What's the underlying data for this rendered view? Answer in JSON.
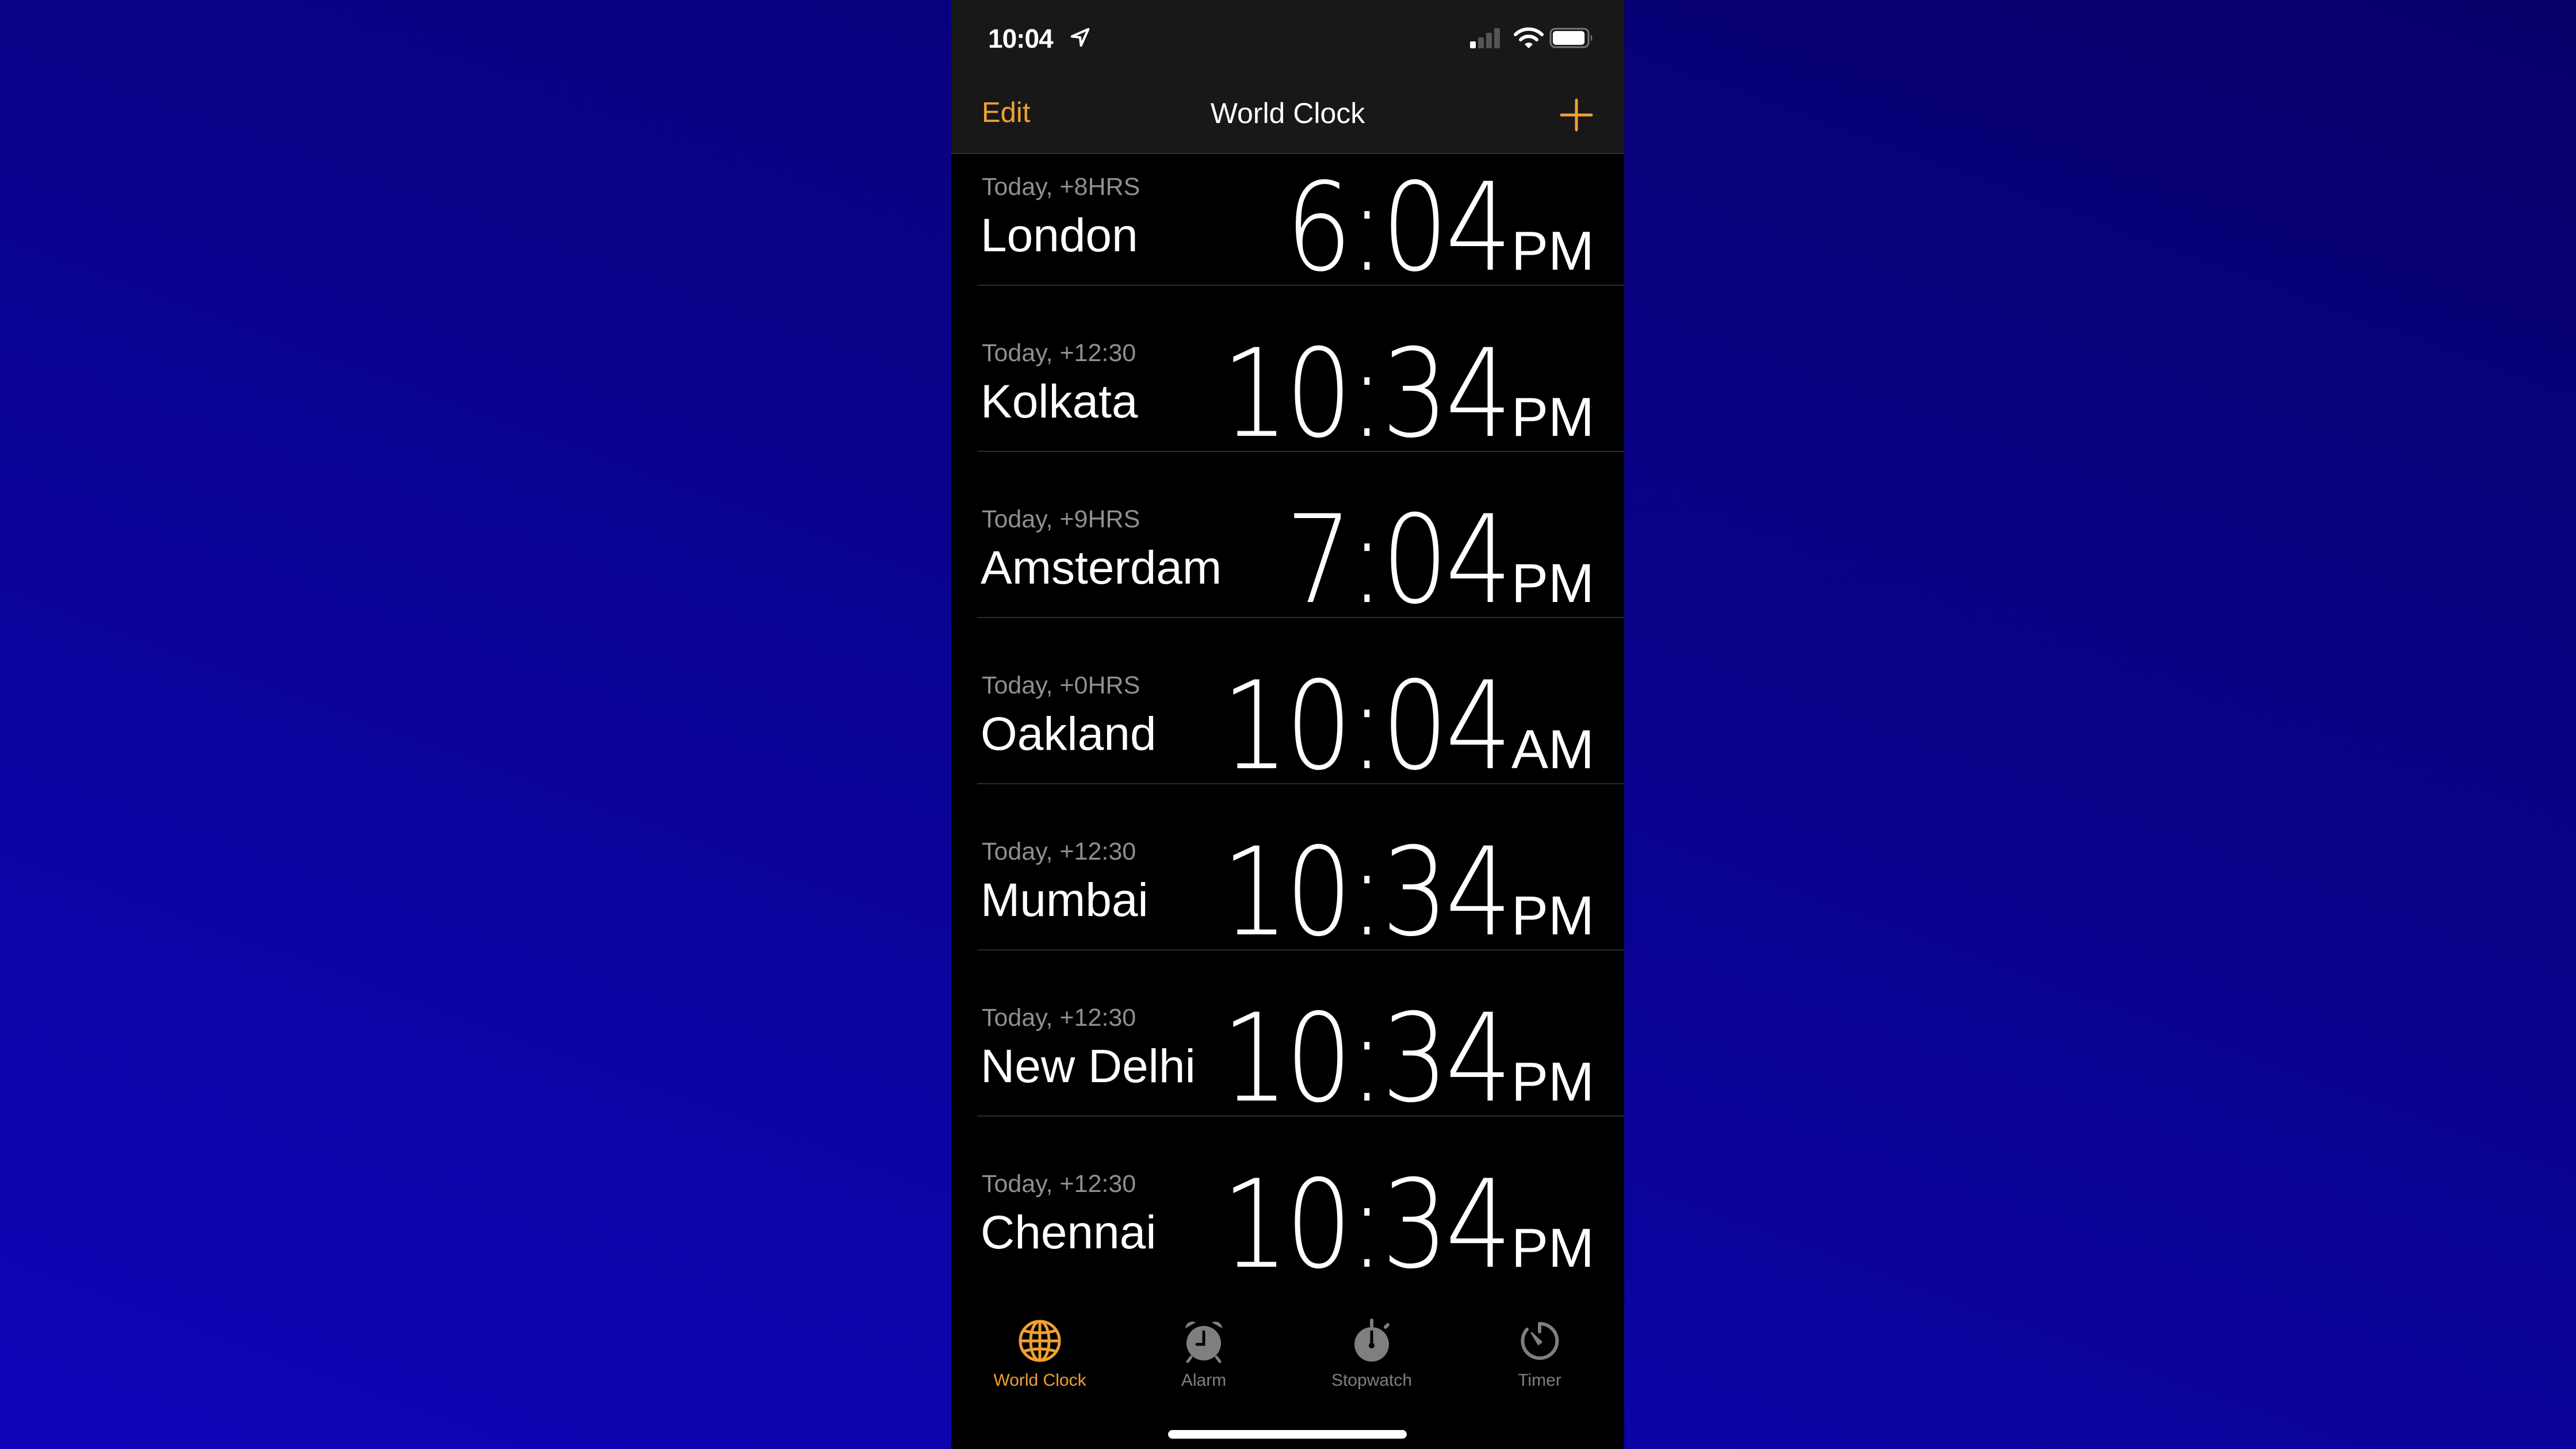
{
  "status_bar": {
    "time": "10:04",
    "location_icon": "location-arrow-icon",
    "signal_bars_lit": 1,
    "signal_bars_total": 4,
    "wifi_icon": "wifi-icon",
    "battery_level": 0.95
  },
  "nav": {
    "edit_label": "Edit",
    "title": "World Clock",
    "add_icon": "plus-icon"
  },
  "clocks": [
    {
      "subtitle": "Today, +8HRS",
      "city": "London",
      "time": "6:04",
      "ampm": "PM"
    },
    {
      "subtitle": "Today, +12:30",
      "city": "Kolkata",
      "time": "10:34",
      "ampm": "PM"
    },
    {
      "subtitle": "Today, +9HRS",
      "city": "Amsterdam",
      "time": "7:04",
      "ampm": "PM"
    },
    {
      "subtitle": "Today, +0HRS",
      "city": "Oakland",
      "time": "10:04",
      "ampm": "AM"
    },
    {
      "subtitle": "Today, +12:30",
      "city": "Mumbai",
      "time": "10:34",
      "ampm": "PM"
    },
    {
      "subtitle": "Today, +12:30",
      "city": "New Delhi",
      "time": "10:34",
      "ampm": "PM"
    },
    {
      "subtitle": "Today, +12:30",
      "city": "Chennai",
      "time": "10:34",
      "ampm": "PM"
    }
  ],
  "tabs": [
    {
      "label": "World Clock",
      "icon": "globe-icon",
      "active": true
    },
    {
      "label": "Alarm",
      "icon": "alarm-clock-icon",
      "active": false
    },
    {
      "label": "Stopwatch",
      "icon": "stopwatch-icon",
      "active": false
    },
    {
      "label": "Timer",
      "icon": "timer-icon",
      "active": false
    }
  ],
  "colors": {
    "accent": "#f0a033",
    "inactive_tab": "#7f7f7f",
    "secondary_text": "#8e8e93",
    "header_bg": "#181818",
    "background_top": "#07006a",
    "background_bottom": "#1104b9"
  }
}
